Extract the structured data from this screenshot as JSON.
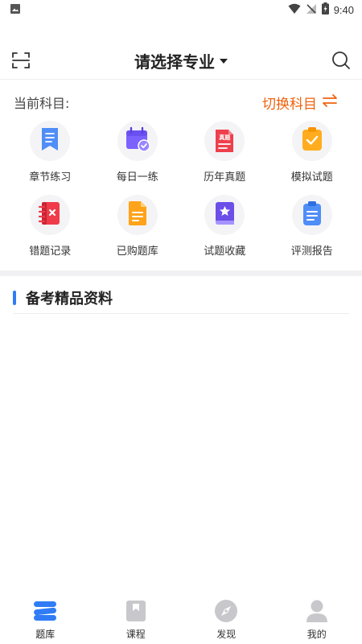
{
  "status_bar": {
    "time": "9:40",
    "icons": [
      "gallery-icon",
      "wifi-icon",
      "signal-off-icon",
      "battery-charging-icon"
    ]
  },
  "header": {
    "title": "请选择专业",
    "icons": [
      "scan-icon",
      "search-icon",
      "caret-down-icon"
    ]
  },
  "subject": {
    "label": "当前科目:",
    "switch_label": "切换科目"
  },
  "colors": {
    "accent_orange": "#f0620f",
    "accent_blue": "#2f7cf6",
    "tab_active": "#2f7cf6",
    "tab_inactive": "#c8c8cc"
  },
  "grid": [
    {
      "label": "章节练习",
      "icon": "bookmark-icon"
    },
    {
      "label": "每日一练",
      "icon": "calendar-check-icon"
    },
    {
      "label": "历年真题",
      "icon": "exam-paper-icon",
      "badge": "真题"
    },
    {
      "label": "模拟试题",
      "icon": "clipboard-check-icon"
    },
    {
      "label": "错题记录",
      "icon": "notebook-x-icon"
    },
    {
      "label": "已购题库",
      "icon": "document-icon"
    },
    {
      "label": "试题收藏",
      "icon": "star-book-icon"
    },
    {
      "label": "评测报告",
      "icon": "report-icon"
    }
  ],
  "section": {
    "title": "备考精品资料"
  },
  "tabs": [
    {
      "label": "题库",
      "icon": "question-bank-icon",
      "active": true
    },
    {
      "label": "课程",
      "icon": "course-icon",
      "active": false
    },
    {
      "label": "发现",
      "icon": "compass-icon",
      "active": false
    },
    {
      "label": "我的",
      "icon": "profile-icon",
      "active": false
    }
  ]
}
